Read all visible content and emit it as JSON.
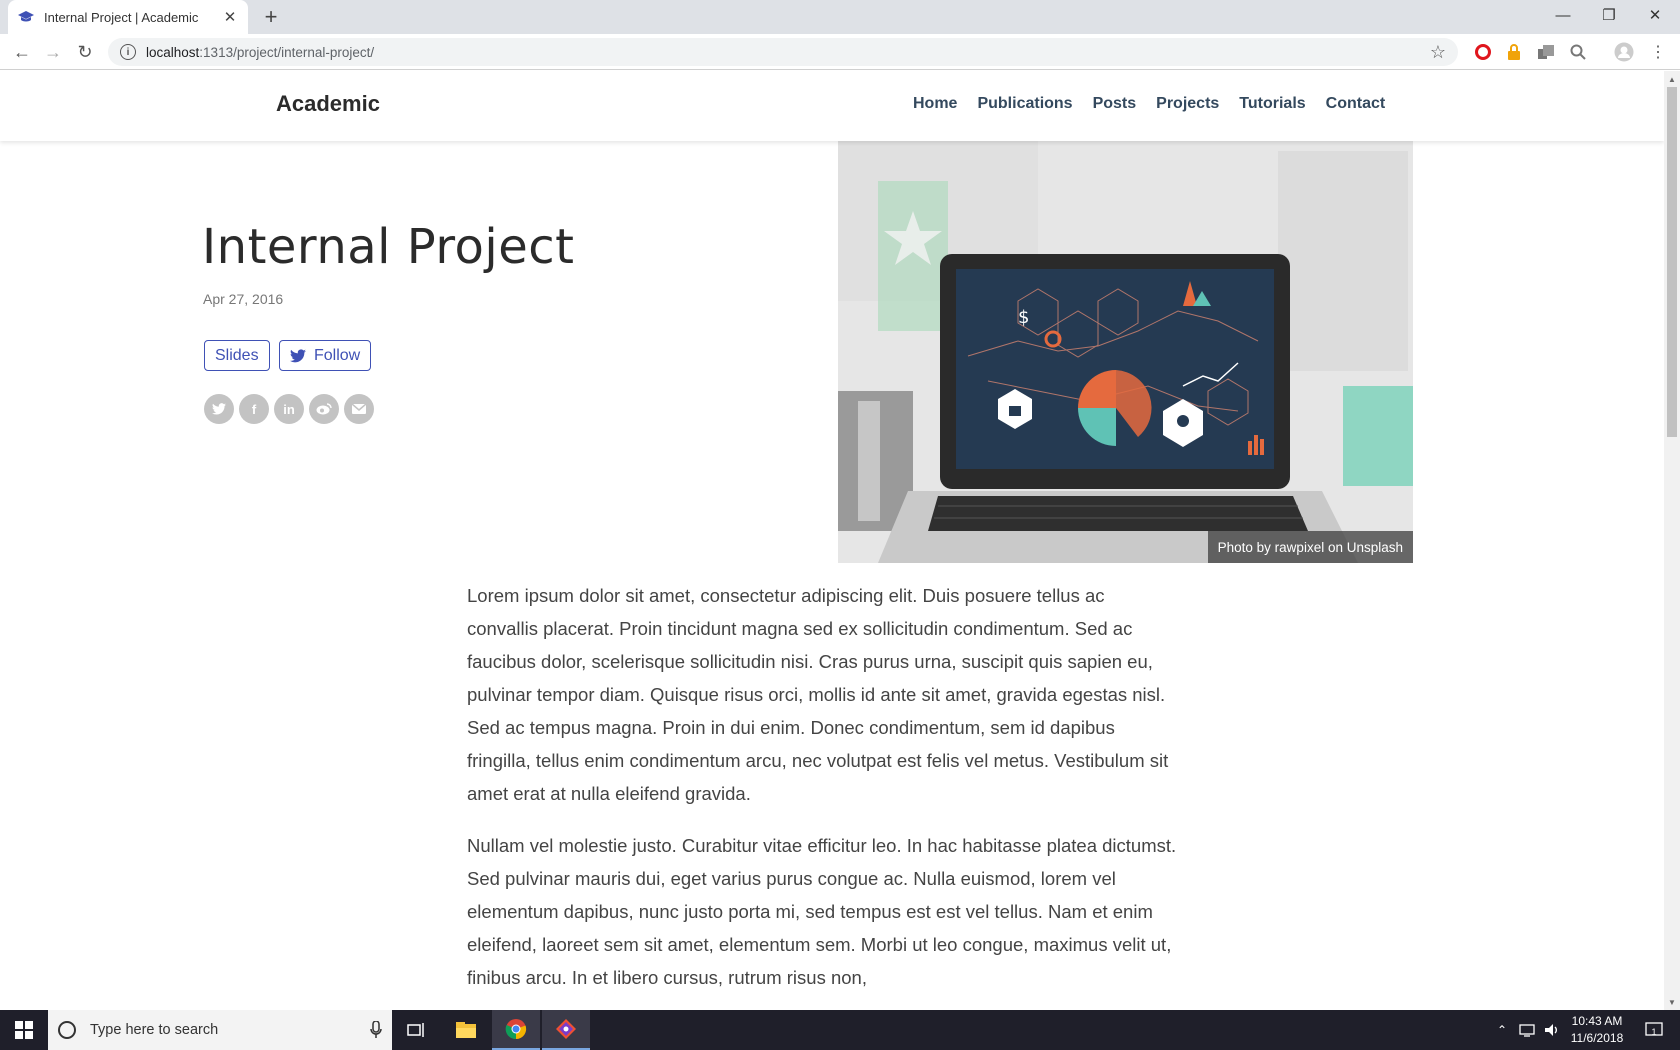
{
  "browser": {
    "tab_title": "Internal Project | Academic",
    "new_tab": "+",
    "url_host": "localhost",
    "url_rest": ":1313/project/internal-project/"
  },
  "site": {
    "brand": "Academic",
    "nav": [
      "Home",
      "Publications",
      "Posts",
      "Projects",
      "Tutorials",
      "Contact"
    ]
  },
  "hero": {
    "title": "Internal Project",
    "date": "Apr 27, 2016",
    "slides_label": "Slides",
    "follow_label": "Follow",
    "image_credit": "Photo by rawpixel on Unsplash",
    "share_icons": [
      "twitter-icon",
      "facebook-icon",
      "linkedin-icon",
      "weibo-icon",
      "email-icon"
    ]
  },
  "content": {
    "p1": "Lorem ipsum dolor sit amet, consectetur adipiscing elit. Duis posuere tellus ac convallis placerat. Proin tincidunt magna sed ex sollicitudin condimentum. Sed ac faucibus dolor, scelerisque sollicitudin nisi. Cras purus urna, suscipit quis sapien eu, pulvinar tempor diam. Quisque risus orci, mollis id ante sit amet, gravida egestas nisl. Sed ac tempus magna. Proin in dui enim. Donec condimentum, sem id dapibus fringilla, tellus enim condimentum arcu, nec volutpat est felis vel metus. Vestibulum sit amet erat at nulla eleifend gravida.",
    "p2": "Nullam vel molestie justo. Curabitur vitae efficitur leo. In hac habitasse platea dictumst. Sed pulvinar mauris dui, eget varius purus congue ac. Nulla euismod, lorem vel elementum dapibus, nunc justo porta mi, sed tempus est est vel tellus. Nam et enim eleifend, laoreet sem sit amet, elementum sem. Morbi ut leo congue, maximus velit ut, finibus arcu. In et libero cursus, rutrum risus non,"
  },
  "taskbar": {
    "search_placeholder": "Type here to search",
    "time": "10:43 AM",
    "date": "11/6/2018",
    "notifications": "1"
  },
  "colors": {
    "accent": "#3f51b5",
    "taskbar": "#1f1f2a"
  }
}
